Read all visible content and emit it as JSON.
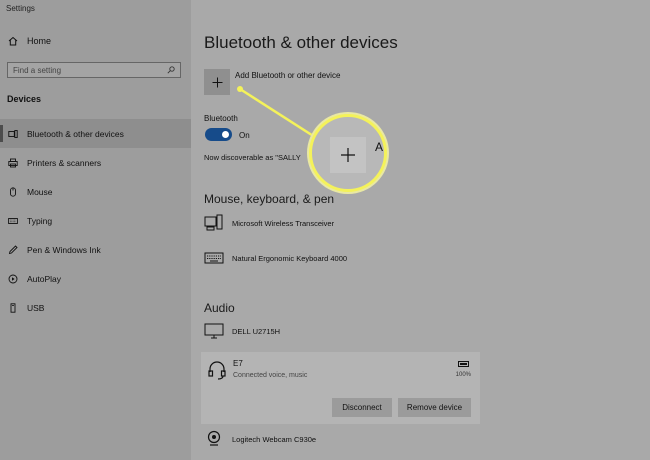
{
  "window": {
    "title": "Settings"
  },
  "sidebar": {
    "home_label": "Home",
    "search_placeholder": "Find a setting",
    "section_title": "Devices",
    "items": [
      {
        "label": "Bluetooth & other devices",
        "icon": "bluetooth-devices-icon",
        "active": true
      },
      {
        "label": "Printers & scanners",
        "icon": "printer-icon"
      },
      {
        "label": "Mouse",
        "icon": "mouse-icon"
      },
      {
        "label": "Typing",
        "icon": "keyboard-icon"
      },
      {
        "label": "Pen & Windows Ink",
        "icon": "pen-icon"
      },
      {
        "label": "AutoPlay",
        "icon": "autoplay-icon"
      },
      {
        "label": "USB",
        "icon": "usb-icon"
      }
    ]
  },
  "main": {
    "title": "Bluetooth & other devices",
    "add_label": "Add Bluetooth or other device",
    "bluetooth": {
      "label": "Bluetooth",
      "state": "On",
      "discoverable": "Now discoverable as \"SALLY"
    },
    "groups": [
      {
        "title": "Mouse, keyboard, & pen",
        "devices": [
          "Microsoft Wireless Transceiver",
          "Natural Ergonomic Keyboard 4000"
        ]
      },
      {
        "title": "Audio",
        "devices": [
          "DELL U2715H"
        ]
      }
    ],
    "selected_device": {
      "name": "E7",
      "status": "Connected voice, music",
      "battery": "100%",
      "disconnect_label": "Disconnect",
      "remove_label": "Remove device"
    },
    "last_device": "Logitech Webcam C930e"
  },
  "callout": {
    "fragment": "A",
    "color": "#f4f25a"
  },
  "colors": {
    "toggle": "#164b8a",
    "sidebar": "#9d9d9d",
    "background": "#a9a9a9"
  }
}
